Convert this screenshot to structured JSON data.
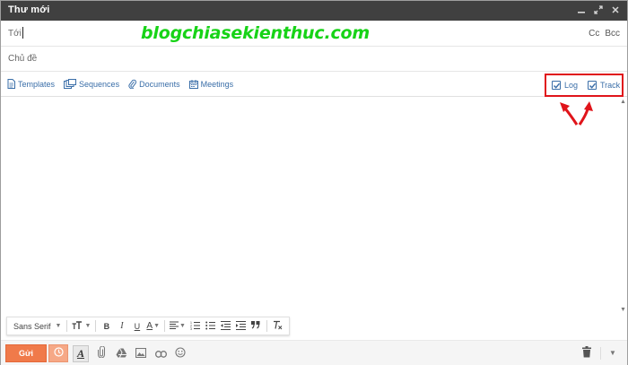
{
  "window": {
    "title": "Thư mới",
    "controls": [
      "minimize-icon",
      "popout-icon",
      "close-icon"
    ]
  },
  "to_row": {
    "label": "Tới",
    "cc": "Cc",
    "bcc": "Bcc"
  },
  "watermark": "blogchiasekienthuc.com",
  "subject_row": {
    "label": "Chủ đề"
  },
  "toolbar": {
    "templates": "Templates",
    "sequences": "Sequences",
    "documents": "Documents",
    "meetings": "Meetings"
  },
  "tracking": {
    "log_label": "Log",
    "log_checked": true,
    "track_label": "Track",
    "track_checked": true,
    "highlight_color": "#e0141a"
  },
  "format_bar": {
    "font": "Sans Serif",
    "size_icon": "font-size-icon",
    "bold": "B",
    "italic": "I",
    "underline": "U",
    "text_color": "A"
  },
  "bottom_bar": {
    "send_label": "Gửi",
    "send_color": "#f07a4a",
    "format_toggle": "A"
  }
}
